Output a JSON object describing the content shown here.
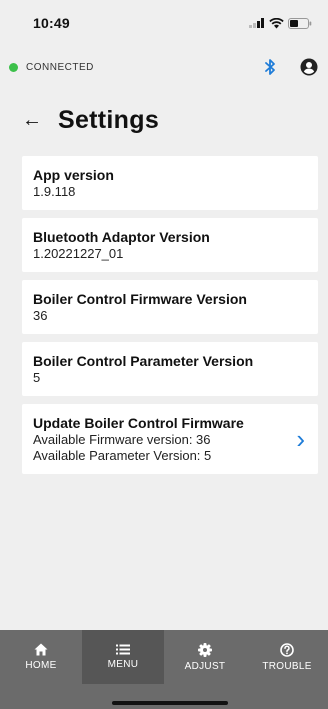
{
  "status_bar": {
    "time": "10:49"
  },
  "connection": {
    "status": "CONNECTED",
    "dot_color": "#3cc04a"
  },
  "header": {
    "title": "Settings"
  },
  "cards": [
    {
      "title": "App version",
      "value": "1.9.118"
    },
    {
      "title": "Bluetooth Adaptor Version",
      "value": "1.20221227_01"
    },
    {
      "title": "Boiler Control Firmware Version",
      "value": "36"
    },
    {
      "title": "Boiler Control Parameter Version",
      "value": "5"
    }
  ],
  "update_card": {
    "title": "Update Boiler Control Firmware",
    "line1": "Available Firmware version: 36",
    "line2": "Available Parameter Version: 5"
  },
  "nav": {
    "items": [
      {
        "label": "HOME",
        "icon": "home-icon"
      },
      {
        "label": "MENU",
        "icon": "menu-icon"
      },
      {
        "label": "ADJUST",
        "icon": "gear-icon"
      },
      {
        "label": "TROUBLE",
        "icon": "help-icon"
      }
    ],
    "active": "MENU"
  },
  "colors": {
    "accent": "#1e7cd8",
    "nav_bg": "#6b6b6b",
    "nav_active_bg": "#565656",
    "page_bg": "#efefef"
  }
}
